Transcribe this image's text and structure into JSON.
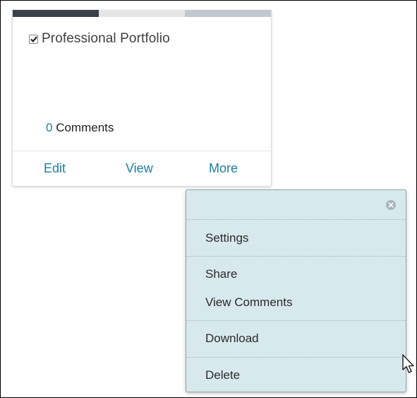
{
  "card": {
    "title": "Professional Portfolio",
    "checked": true,
    "comments_count": "0",
    "comments_label": "Comments",
    "actions": {
      "edit": "Edit",
      "view": "View",
      "more": "More"
    },
    "bar_colors": [
      "#3b4149",
      "#e4e5e6",
      "#c1c7ce"
    ],
    "link_color": "#1b7ea2"
  },
  "menu": {
    "close_icon": "close-circle-icon",
    "items": [
      {
        "label": "Settings"
      },
      {
        "label": "Share"
      },
      {
        "label": "View Comments"
      },
      {
        "label": "Download"
      },
      {
        "label": "Delete"
      }
    ],
    "background": "#d8e9ee"
  },
  "cursor_icon": "mouse-pointer-icon"
}
